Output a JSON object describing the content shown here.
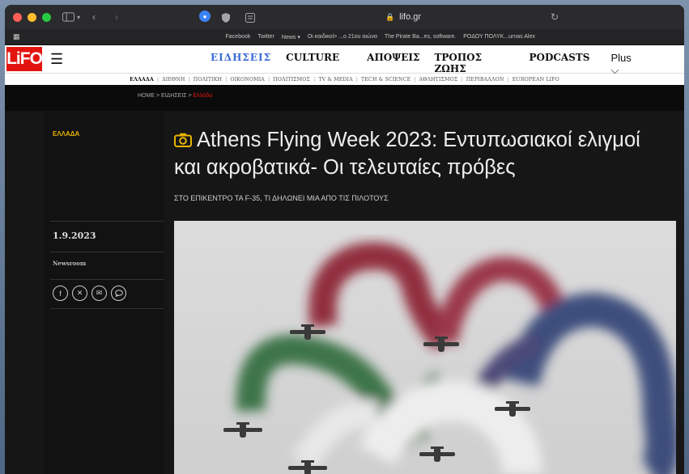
{
  "browser": {
    "url": "lifo.gr",
    "bookmarks": [
      "Facebook",
      "Twitter",
      "News ▾",
      "Οι καιδικοί> ...ο 21ου αιώνα",
      "The Pirate Ba...es, software.",
      "ΡΟΔΟΥ ΠΟΛΥΚ...urnas Alex"
    ]
  },
  "site": {
    "logo": "LiFO",
    "nav": [
      "ΕΙΔΗΣΕΙΣ",
      "CULTURE",
      "ΑΠΟΨΕΙΣ",
      "ΤΡΟΠΟΣ ΖΩΗΣ",
      "PODCASTS"
    ],
    "nav_plus": "Plus",
    "subnav": [
      "ΕΛΛΑΔΑ",
      "ΔΙΕΘΝΗ",
      "ΠΟΛΙΤΙΚΗ",
      "ΟΙΚΟΝΟΜΙΑ",
      "ΠΟΛΙΤΙΣΜΟΣ",
      "TV & MEDIA",
      "TECH & SCIENCE",
      "ΑΘΛΗΤΙΣΜΟΣ",
      "ΠΕΡΙΒΑΛΛΟΝ",
      "EUROPEAN LIFO"
    ]
  },
  "breadcrumb": {
    "home": "HOME",
    "section": "ΕΙΔΗΣΕΙΣ",
    "current": "Ελλάδα"
  },
  "article": {
    "category": "ΕΛΛΑΔΑ",
    "title": "Athens Flying Week 2023: Εντυπωσιακοί ελιγμοί και ακροβατικά- Οι τελευταίες πρόβες",
    "subtitle": "ΣΤΟ ΕΠΙΚΕΝΤΡΟ ΤΑ F-35, ΤΙ ΔΗΛΩΝΕΙ ΜΙΑ ΑΠΟ ΤΙΣ ΠΙΛΟΤΟΥΣ",
    "date": "1.9.2023",
    "author": "Newsroom",
    "share_icons": [
      "facebook-icon",
      "x-icon",
      "email-icon",
      "comment-icon"
    ]
  },
  "colors": {
    "brand": "#e3140f",
    "category": "#e8b400",
    "news_link": "#3b6bd8"
  }
}
